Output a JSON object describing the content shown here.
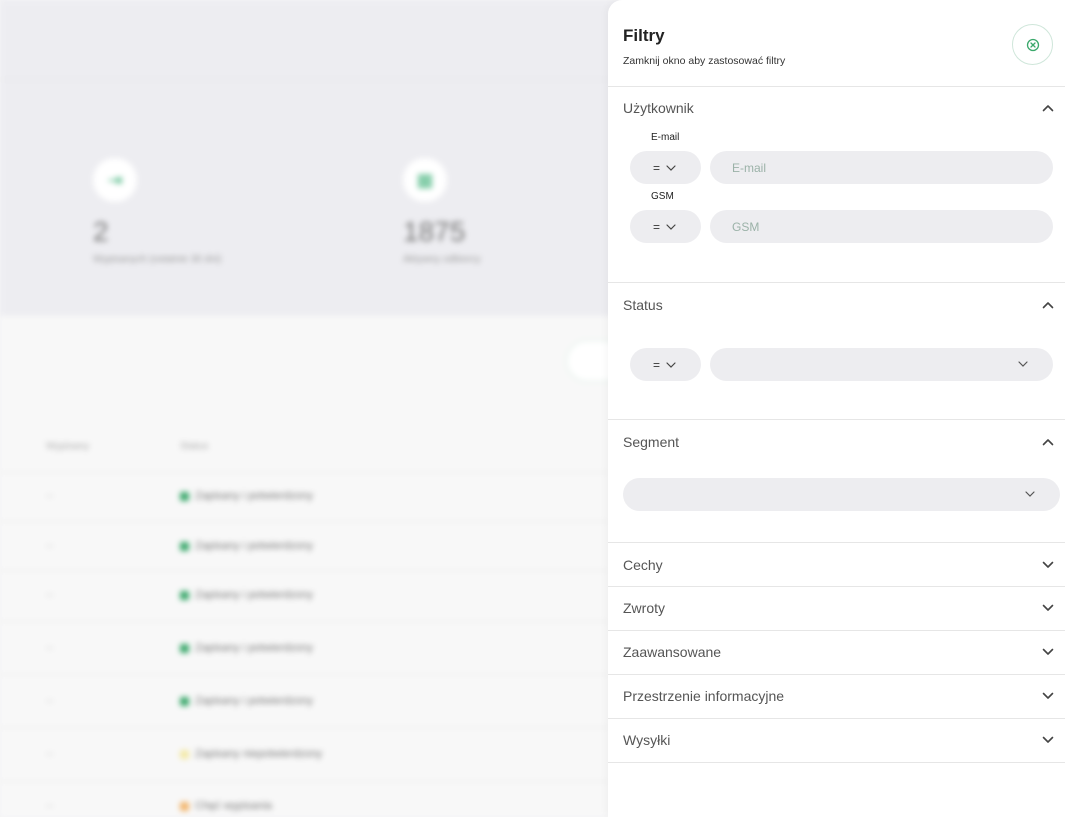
{
  "background": {
    "stats": [
      {
        "value": "2",
        "label": "Wypisanych (ostatnie 30 dni)",
        "icon": "exit-icon"
      },
      {
        "value": "1875",
        "label": "Aktywny odbiorcy",
        "icon": "grid-icon"
      }
    ],
    "table": {
      "headers": [
        "Wypisany",
        "Status"
      ],
      "rows": [
        {
          "col1": "--",
          "status": "Zapisany i potwierdzony",
          "color": "#3aa86b"
        },
        {
          "col1": "--",
          "status": "Zapisany i potwierdzony",
          "color": "#3aa86b"
        },
        {
          "col1": "--",
          "status": "Zapisany i potwierdzony",
          "color": "#3aa86b"
        },
        {
          "col1": "--",
          "status": "Zapisany i potwierdzony",
          "color": "#3aa86b"
        },
        {
          "col1": "--",
          "status": "Zapisany i potwierdzony",
          "color": "#3aa86b"
        },
        {
          "col1": "--",
          "status": "Zapisany niepotwierdzony",
          "color": "#f3e9a6"
        },
        {
          "col1": "--",
          "status": "Chęć wypisania",
          "color": "#f2b46a"
        }
      ]
    }
  },
  "panel": {
    "title": "Filtry",
    "subtitle": "Zamknij okno aby zastosować filtry",
    "close_icon": "close-circle-icon",
    "accent": "#3aa86b",
    "sections": {
      "uzytkownik": {
        "title": "Użytkownik",
        "expanded": true,
        "email": {
          "label": "E-mail",
          "operator": "=",
          "placeholder": "E-mail",
          "value": ""
        },
        "gsm": {
          "label": "GSM",
          "operator": "=",
          "placeholder": "GSM",
          "value": ""
        }
      },
      "status": {
        "title": "Status",
        "expanded": true,
        "operator": "=",
        "value": ""
      },
      "segment": {
        "title": "Segment",
        "expanded": true,
        "value": ""
      },
      "cechy": {
        "title": "Cechy",
        "expanded": false
      },
      "zwroty": {
        "title": "Zwroty",
        "expanded": false
      },
      "zaawansowane": {
        "title": "Zaawansowane",
        "expanded": false
      },
      "przestrzenie": {
        "title": "Przestrzenie informacyjne",
        "expanded": false
      },
      "wysylki": {
        "title": "Wysyłki",
        "expanded": false
      }
    }
  }
}
